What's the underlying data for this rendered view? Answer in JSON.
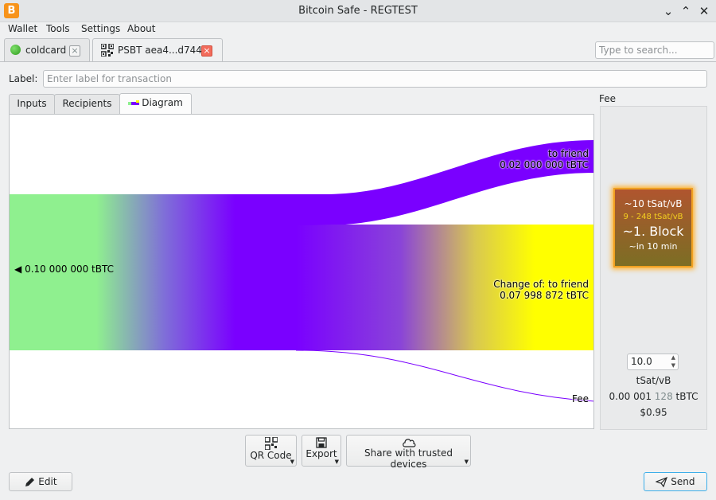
{
  "window": {
    "title": "Bitcoin Safe - REGTEST",
    "app_icon_glyph": "B",
    "controls": [
      "minimize",
      "maximize",
      "close"
    ]
  },
  "menu": [
    "Wallet",
    "Tools",
    "Settings",
    "About"
  ],
  "tabs": [
    {
      "label": "coldcard",
      "icon": "green-circle-icon",
      "close_color": "#f0f0f0"
    },
    {
      "label": "PSBT aea4...d744",
      "icon": "qr-code-icon",
      "close_color": "#f26b5b"
    }
  ],
  "search": {
    "placeholder": "Type to search...",
    "value": ""
  },
  "label_field": {
    "label": "Label:",
    "placeholder": "Enter label for transaction",
    "value": ""
  },
  "inner_tabs": [
    "Inputs",
    "Recipients",
    "Diagram"
  ],
  "diagram": {
    "input_label": "0.10 000 000 tBTC",
    "outputs": [
      {
        "name": "to friend",
        "amount": "0.02 000 000 tBTC",
        "color": "#7a00ff"
      },
      {
        "name": "Change of: to friend",
        "amount": "0.07 998 872 tBTC",
        "color": "#ffff00"
      },
      {
        "name": "Fee",
        "amount": "",
        "color": "#7a00ff"
      }
    ],
    "input_color": "#8ff08f"
  },
  "fee": {
    "title": "Fee",
    "block": {
      "rate": "~10 tSat/vB",
      "range": "9 - 248 tSat/vB",
      "block": "~1. Block",
      "eta": "~in 10 min"
    },
    "spin_value": "10.0",
    "unit": "tSat/vB",
    "amount_parts": [
      "0.00 ",
      "001 ",
      "128",
      " tBTC"
    ],
    "fiat": "$0.95"
  },
  "buttons": {
    "qr": "QR Code",
    "export": "Export",
    "share": "Share with trusted devices",
    "edit": "Edit",
    "send": "Send"
  }
}
